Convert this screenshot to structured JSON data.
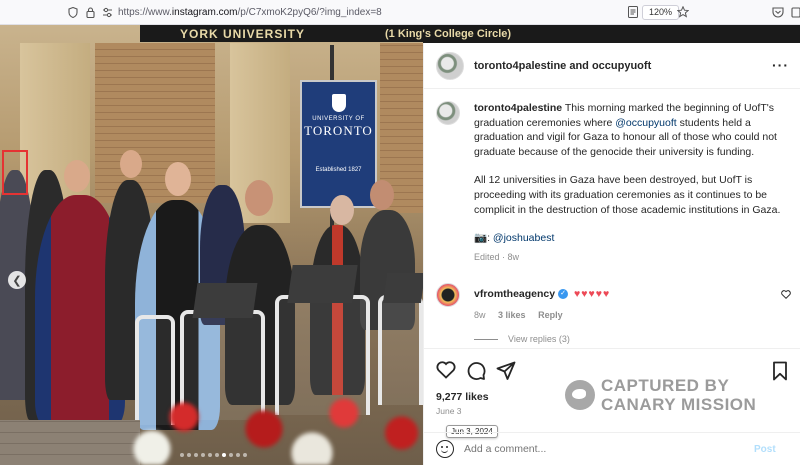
{
  "browser": {
    "url_prefix": "https://www.",
    "url_host": "instagram.com",
    "url_path": "/p/C7xmoK2pyQ6/?img_index=8",
    "zoom": "120%"
  },
  "photo": {
    "banner_left": "YORK UNIVERSITY",
    "banner_right": "(1 King's College Circle)",
    "uoft_line1": "UNIVERSITY OF",
    "uoft_line2": "TORONTO",
    "uoft_est": "Established 1827"
  },
  "post": {
    "header_name": "toronto4palestine and occupyuoft",
    "caption": {
      "author": "toronto4palestine",
      "p1_before": " This morning marked the beginning of UofT's graduation ceremonies where ",
      "p1_mention": "@occupyuoft",
      "p1_after": " students held a graduation and vigil for Gaza to honour all of those who could not graduate because of the genocide their university is funding.",
      "p2": "All 12 universities in Gaza have been destroyed, but UofT is proceeding with its graduation ceremonies as it continues to be complicit in the destruction of those academic institutions in Gaza.",
      "p3_prefix": "📷: ",
      "p3_mention": "@joshuabest",
      "meta": "Edited · 8w"
    },
    "comment": {
      "author": "vfromtheagency",
      "hearts": "♥♥♥♥♥",
      "age": "8w",
      "likes": "3 likes",
      "reply": "Reply",
      "view_replies": "View replies (3)"
    },
    "likes": "9,277 likes",
    "date": "June 3",
    "tooltip": "Jun 3, 2024",
    "comment_placeholder": "Add a comment...",
    "post_label": "Post"
  },
  "watermark": {
    "line1": "CAPTURED BY",
    "line2": "CANARY MISSION"
  }
}
